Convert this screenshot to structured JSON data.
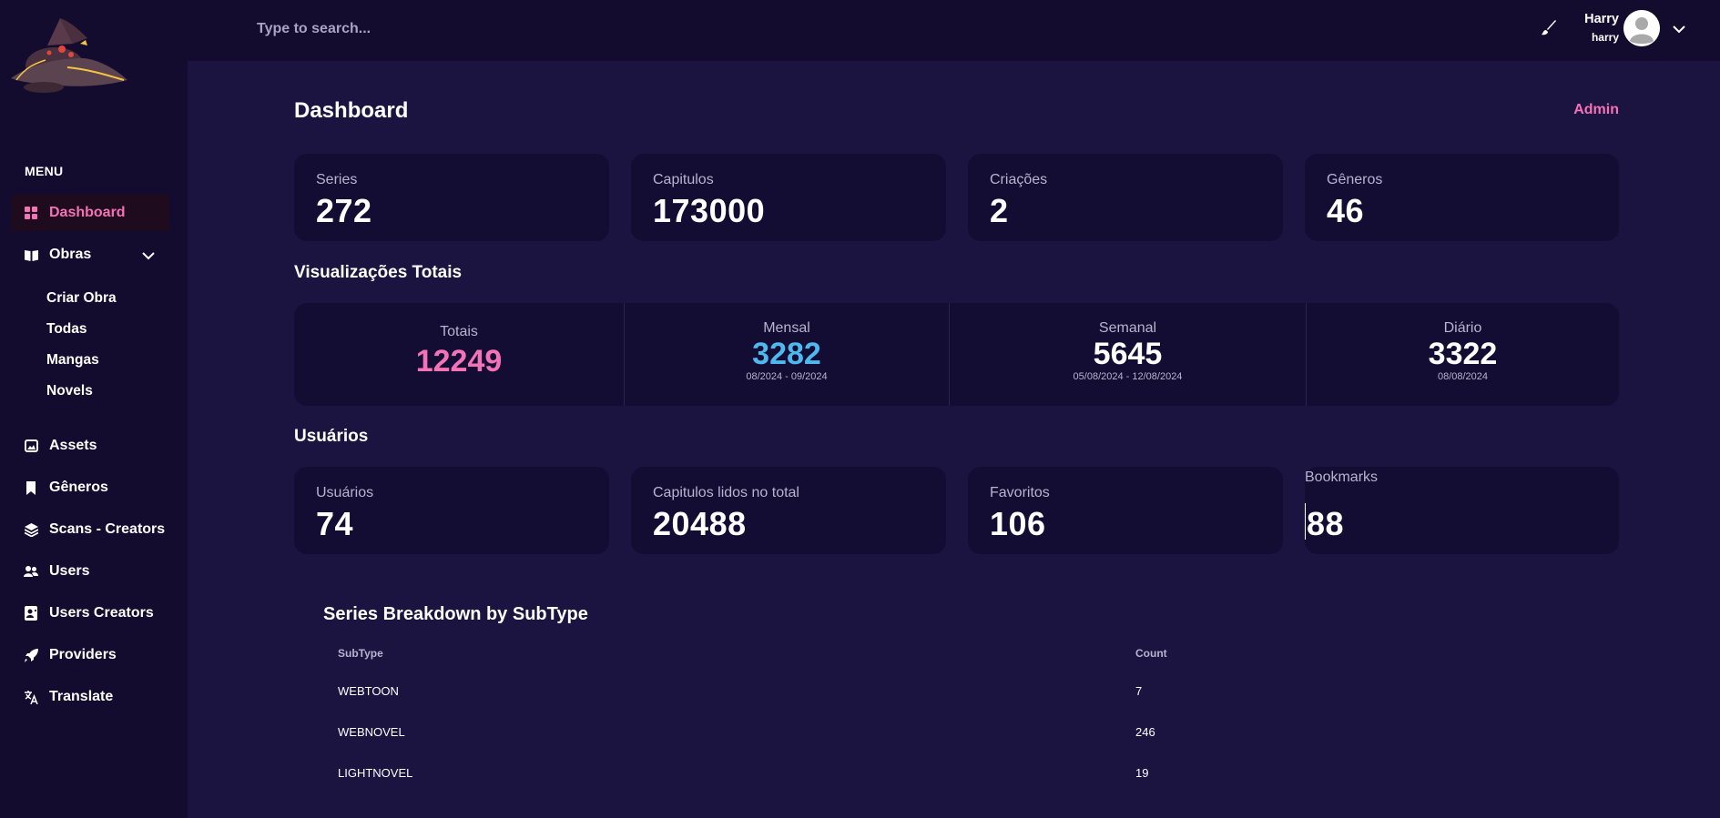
{
  "colors": {
    "background": "#1b1340",
    "sidebar": "#130c2f",
    "card": "#140d33",
    "accent_pink": "#f472b6",
    "accent_blue": "#4fb8ee"
  },
  "topbar": {
    "search_placeholder": "Type to search...",
    "user_name": "Harry",
    "user_handle": "harry"
  },
  "sidebar": {
    "menu_heading": "MENU",
    "items": [
      {
        "label": "Dashboard",
        "icon": "grid-icon"
      },
      {
        "label": "Obras",
        "icon": "book-icon"
      },
      {
        "label": "Assets",
        "icon": "image-icon"
      },
      {
        "label": "Gêneros",
        "icon": "bookmark-icon"
      },
      {
        "label": "Scans - Creators",
        "icon": "layers-icon"
      },
      {
        "label": "Users",
        "icon": "users-icon"
      },
      {
        "label": "Users Creators",
        "icon": "contact-card-icon"
      },
      {
        "label": "Providers",
        "icon": "rocket-icon"
      },
      {
        "label": "Translate",
        "icon": "translate-icon"
      }
    ],
    "obras_sub": [
      "Criar Obra",
      "Todas",
      "Mangas",
      "Novels"
    ]
  },
  "main": {
    "title": "Dashboard",
    "admin_label": "Admin",
    "stats": [
      {
        "label": "Series",
        "value": "272"
      },
      {
        "label": "Capitulos",
        "value": "173000"
      },
      {
        "label": "Criações",
        "value": "2"
      },
      {
        "label": "Gêneros",
        "value": "46"
      }
    ],
    "views_title": "Visualizações Totais",
    "views": [
      {
        "label": "Totais",
        "value": "12249",
        "range": ""
      },
      {
        "label": "Mensal",
        "value": "3282",
        "range": "08/2024 - 09/2024"
      },
      {
        "label": "Semanal",
        "value": "5645",
        "range": "05/08/2024 - 12/08/2024"
      },
      {
        "label": "Diário",
        "value": "3322",
        "range": "08/08/2024"
      }
    ],
    "users_title": "Usuários",
    "user_stats": [
      {
        "label": "Usuários",
        "value": "74"
      },
      {
        "label": "Capitulos lidos no total",
        "value": "20488"
      },
      {
        "label": "Favoritos",
        "value": "106"
      },
      {
        "label": "Bookmarks",
        "value": "88"
      }
    ],
    "table": {
      "title": "Series Breakdown by SubType",
      "headers": [
        "SubType",
        "Count"
      ],
      "rows": [
        [
          "WEBTOON",
          "7"
        ],
        [
          "WEBNOVEL",
          "246"
        ],
        [
          "LIGHTNOVEL",
          "19"
        ]
      ]
    }
  }
}
